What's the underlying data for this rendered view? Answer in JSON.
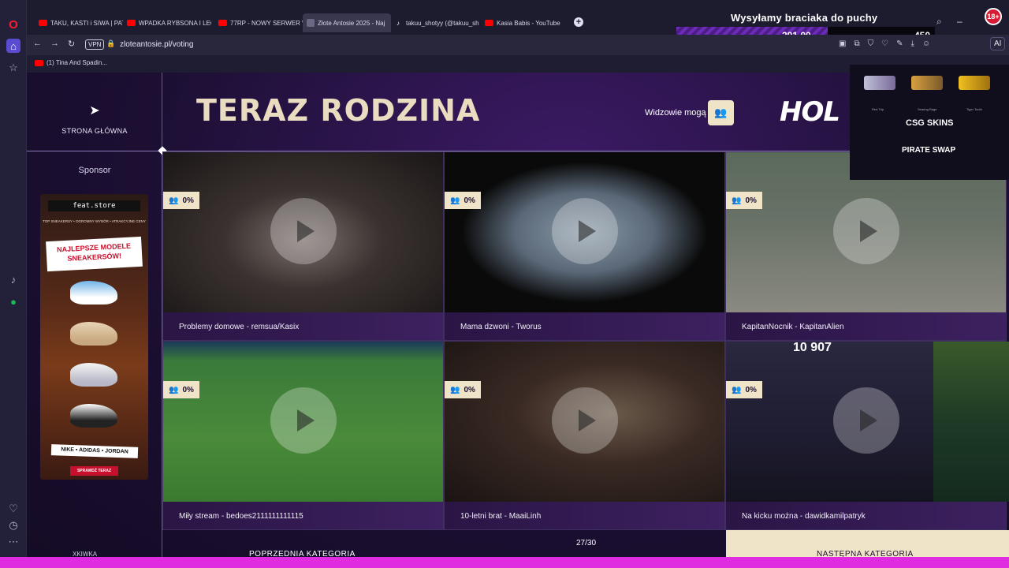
{
  "browser": {
    "tabs": [
      {
        "label": "TAKU, KASTI i SIWA | PATR",
        "icon": "youtube-icon"
      },
      {
        "label": "WPADKA RYBSONA I LEQ",
        "icon": "youtube-icon"
      },
      {
        "label": "77RP - NOWY SERWER W",
        "icon": "youtube-icon"
      },
      {
        "label": "Złote Antosie 2025 - Naj",
        "icon": "page-icon"
      },
      {
        "label": "takuu_shotyy (@takuu_sh",
        "icon": "tiktok-icon"
      },
      {
        "label": "Kasia Babis - YouTube",
        "icon": "youtube-icon"
      }
    ],
    "vpn_label": "VPN",
    "url": "zloteantosie.pl/voting",
    "ai_label": "AI",
    "bookmark": "(1) Tina And Spadin..."
  },
  "overlay": {
    "title": "Wysyłamy braciaka do puchy",
    "value_left": "291.00",
    "value_right": "450",
    "badge": "18+",
    "csg": "CSG SKINS",
    "pirate": "PIRATE SWAP",
    "viewers_count": "10 907",
    "skins": [
      "Red Trip",
      "Searing Rage",
      "Tiger Tooth"
    ]
  },
  "page": {
    "home_label": "STRONA GŁÓWNA",
    "category_title": "TERAZ RODZINA",
    "viewers_label": "Widzowie mogą",
    "brand_logo": "HOL",
    "sponsor_label": "Sponsor",
    "ad": {
      "brand": "feat.store",
      "tagline": "TOP SNEAKERSY • OGROMNY WYBÓR • ATRAKCYJNE CENY",
      "title": "NAJLEPSZE MODELE SNEAKERSÓW!",
      "brands": "NIKE • ADIDAS • JORDAN",
      "cta": "SPRAWDŹ TERAZ"
    },
    "videos": [
      {
        "title": "Problemy domowe - remsua/Kasix",
        "percent": "0%"
      },
      {
        "title": "Mama dzwoni - Tworus",
        "percent": "0%"
      },
      {
        "title": "KapitanNocnik - KapitanAlien",
        "percent": "0%"
      },
      {
        "title": "Miły stream - bedoes2111111111115",
        "percent": "0%"
      },
      {
        "title": "10-letni brat - MaaiLinh",
        "percent": "0%"
      },
      {
        "title": "Na kicku można - dawidkamilpatryk",
        "percent": "0%"
      }
    ],
    "counter": "27/30",
    "prev_category": "POPRZEDNIA KATEGORIA",
    "next_category": "NASTĘPNA KATEGORIA",
    "user_mini": "XKIWKA"
  }
}
